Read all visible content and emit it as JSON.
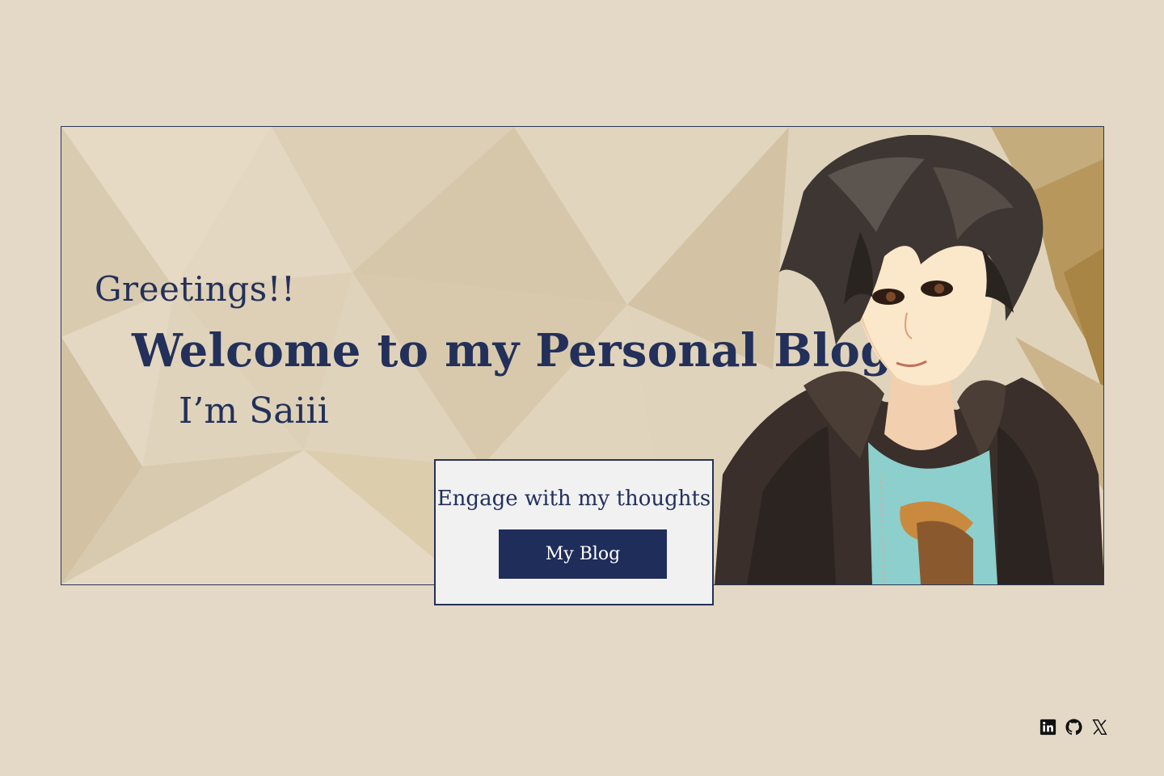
{
  "hero": {
    "greeting": "Greetings!!",
    "welcome": "Welcome to my Personal Blog",
    "name": "I’m Saiii"
  },
  "cta": {
    "text": "Engage with my thoughts",
    "button_label": "My Blog"
  },
  "social": [
    {
      "name": "linkedin-icon"
    },
    {
      "name": "github-icon"
    },
    {
      "name": "x-icon"
    }
  ],
  "colors": {
    "page_background": "#e4d9c6",
    "accent_navy": "#1f2d5a",
    "cta_box_background": "#f1f1f2"
  }
}
